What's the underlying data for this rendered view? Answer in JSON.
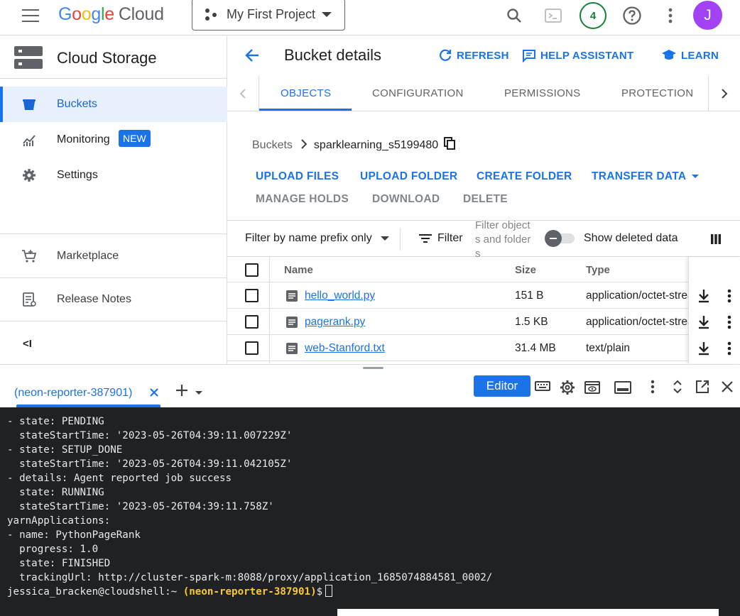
{
  "header": {
    "logo_google": [
      "G",
      "o",
      "o",
      "g",
      "l",
      "e"
    ],
    "logo_cloud": "Cloud",
    "project_name": "My First Project",
    "notifications_count": "4",
    "avatar_initial": "J"
  },
  "sidebar": {
    "title": "Cloud Storage",
    "items": [
      {
        "label": "Buckets",
        "icon": "bucket-icon",
        "active": true
      },
      {
        "label": "Monitoring",
        "icon": "chart-icon",
        "badge": "NEW"
      },
      {
        "label": "Settings",
        "icon": "gear-icon"
      }
    ],
    "secondary": [
      {
        "label": "Marketplace",
        "icon": "cart-icon"
      },
      {
        "label": "Release Notes",
        "icon": "notes-icon"
      }
    ],
    "collapse_label": "<I"
  },
  "page": {
    "title": "Bucket details",
    "actions": {
      "refresh": "REFRESH",
      "help": "HELP ASSISTANT",
      "learn": "LEARN"
    },
    "tabs": [
      "OBJECTS",
      "CONFIGURATION",
      "PERMISSIONS",
      "PROTECTION"
    ],
    "breadcrumb": {
      "root": "Buckets",
      "current": "sparklearning_s5199480"
    },
    "object_actions": {
      "upload_files": "UPLOAD FILES",
      "upload_folder": "UPLOAD FOLDER",
      "create_folder": "CREATE FOLDER",
      "transfer_data": "TRANSFER DATA",
      "manage_holds": "MANAGE HOLDS",
      "download": "DOWNLOAD",
      "delete": "DELETE"
    },
    "filter": {
      "mode": "Filter by name prefix only",
      "button": "Filter",
      "placeholder": "Filter objects and folders",
      "show_deleted": "Show deleted data"
    },
    "table": {
      "headers": {
        "name": "Name",
        "size": "Size",
        "type": "Type"
      },
      "rows": [
        {
          "name": "hello_world.py",
          "size": "151 B",
          "type": "application/octet-stream"
        },
        {
          "name": "pagerank.py",
          "size": "1.5 KB",
          "type": "application/octet-stream"
        },
        {
          "name": "web-Stanford.txt",
          "size": "31.4 MB",
          "type": "text/plain"
        }
      ]
    }
  },
  "shell": {
    "tab_label": "(neon-reporter-387901)",
    "editor_label": "Editor",
    "lines": [
      "- state: PENDING",
      "  stateStartTime: '2023-05-26T04:39:11.007229Z'",
      "- state: SETUP_DONE",
      "  stateStartTime: '2023-05-26T04:39:11.042105Z'",
      "- details: Agent reported job success",
      "  state: RUNNING",
      "  stateStartTime: '2023-05-26T04:39:11.758Z'",
      "yarnApplications:",
      "- name: PythonPageRank",
      "  progress: 1.0",
      "  state: FINISHED",
      "  trackingUrl: http://cluster-spark-m:8088/proxy/application_1685074884581_0002/"
    ],
    "prompt_user": "jessica_bracken@cloudshell:~",
    "prompt_project": "(neon-reporter-387901)",
    "prompt_symbol": "$"
  }
}
